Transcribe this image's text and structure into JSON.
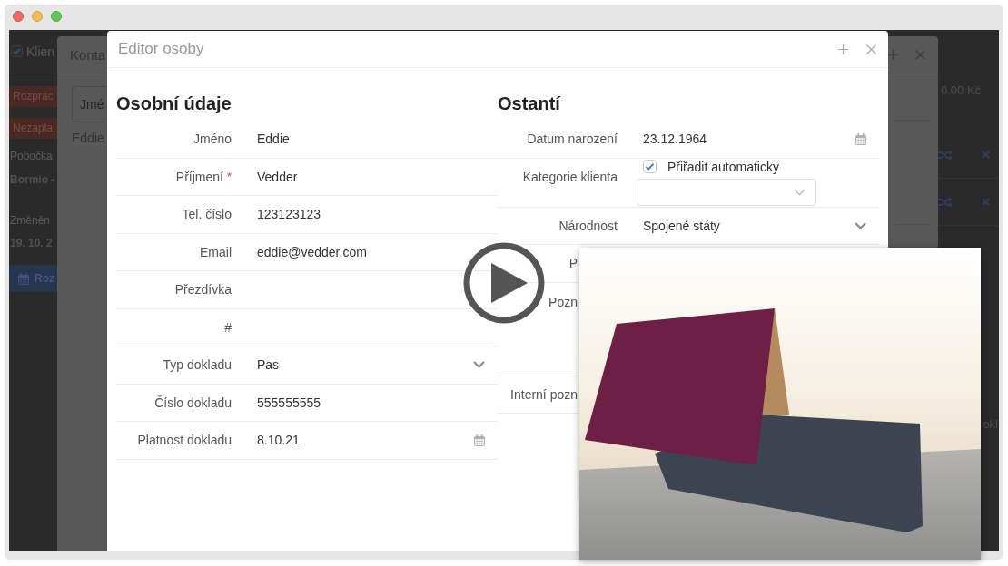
{
  "background_app": {
    "header": {
      "title": "Klien",
      "checked": true
    },
    "badges": [
      {
        "label": "Rozprac"
      },
      {
        "label": "Nezapla"
      }
    ],
    "details": [
      {
        "label": "Pobočka",
        "value": "Bormio -"
      },
      {
        "label": "Změněn",
        "value": "19. 10. 2"
      }
    ],
    "button": {
      "label": "Roz"
    },
    "price": "0.00 Kč",
    "action_rows": [
      {
        "kind": "shuffle-remove"
      },
      {
        "kind": "shuffle-remove"
      }
    ],
    "edge_text": "okl"
  },
  "contact_dialog": {
    "title": "Konta",
    "search": {
      "placeholder": "Jmé"
    },
    "result": "Eddie"
  },
  "person_editor": {
    "title": "Editor osoby",
    "sections": [
      {
        "heading": "Osobní údaje",
        "fields": [
          {
            "kind": "text",
            "label": "Jméno",
            "value": "Eddie"
          },
          {
            "kind": "text",
            "label": "Příjmení",
            "required_mark": "*",
            "value": "Vedder"
          },
          {
            "kind": "text",
            "label": "Tel. číslo",
            "value": "123123123"
          },
          {
            "kind": "text",
            "label": "Email",
            "value": "eddie@vedder.com"
          },
          {
            "kind": "text",
            "label": "Přezdívka"
          },
          {
            "kind": "text",
            "label": "#"
          },
          {
            "kind": "select",
            "label": "Typ dokladu",
            "value": "Pas"
          },
          {
            "kind": "text",
            "label": "Číslo dokladu",
            "value": "555555555"
          },
          {
            "kind": "date",
            "label": "Platnost dokladu",
            "value": "8.10.21"
          }
        ]
      },
      {
        "heading": "Ostantí",
        "fields": [
          {
            "kind": "date",
            "label": "Datum narození",
            "value": "23.12.1964"
          },
          {
            "kind": "category",
            "label": "Kategorie klienta",
            "checkbox": {
              "label": "Přiřadit automaticky",
              "checked": true
            }
          },
          {
            "kind": "select",
            "label": "Národnost",
            "value": "Spojené státy"
          },
          {
            "kind": "text",
            "label": "P"
          },
          {
            "kind": "textarea",
            "label": "Pozn"
          },
          {
            "kind": "text",
            "label": "Interní pozn"
          }
        ]
      }
    ]
  }
}
